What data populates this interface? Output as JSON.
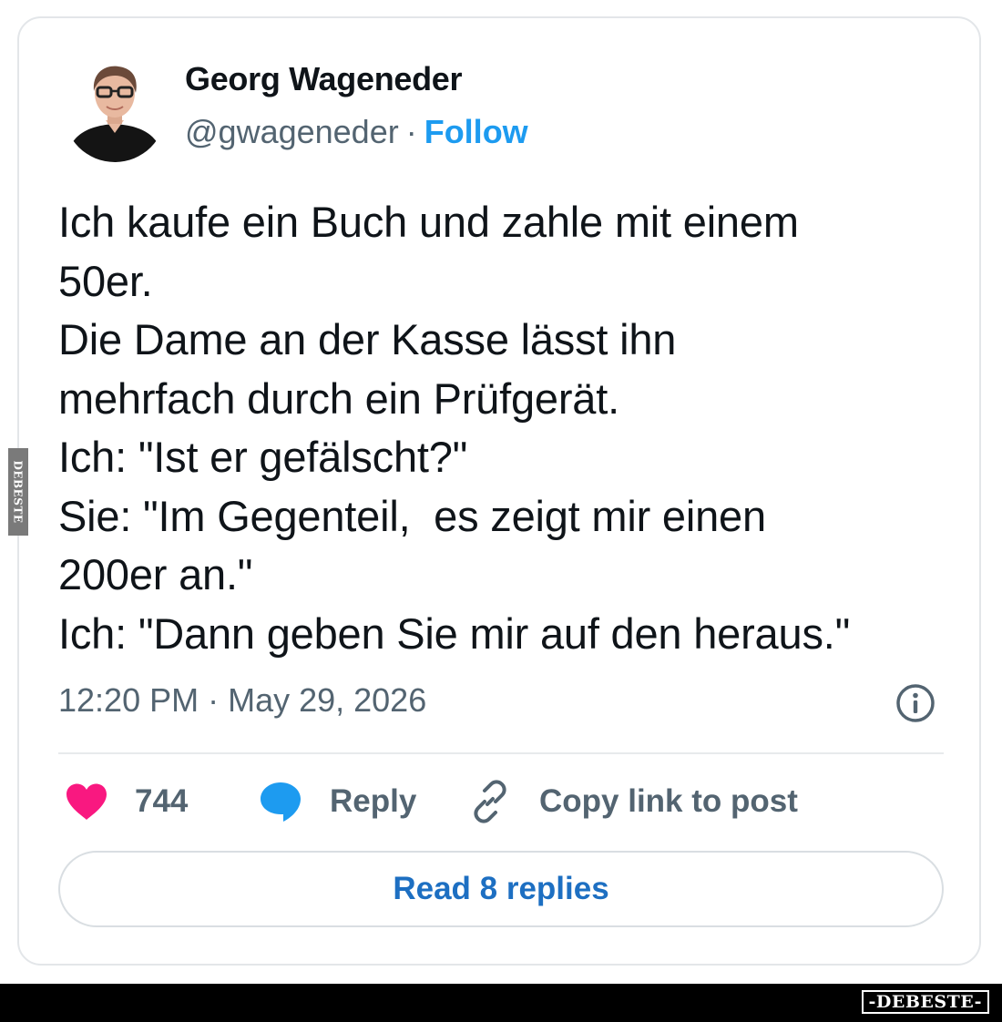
{
  "author": {
    "name": "Georg Wageneder",
    "handle": "@gwageneder",
    "separator": "·",
    "follow_label": "Follow"
  },
  "tweet": {
    "text": "Ich kaufe ein Buch und zahle mit einem\n50er.\nDie Dame an der Kasse lässt ihn\nmehrfach durch ein Prüfgerät.\nIch: \"Ist er gefälscht?\"\nSie: \"Im Gegenteil,  es zeigt mir einen\n200er an.\"\nIch: \"Dann geben Sie mir auf den heraus.\"",
    "timestamp": "12:20 PM · May 29, 2026"
  },
  "actions": {
    "like_count": "744",
    "reply_label": "Reply",
    "copy_label": "Copy link to post",
    "read_replies_label": "Read 8 replies"
  },
  "icons": {
    "like": "heart-icon",
    "reply": "speech-bubble-icon",
    "copy": "link-icon",
    "info": "info-icon"
  },
  "colors": {
    "like": "#f91880",
    "reply": "#1d9bf0",
    "follow": "#1d9bf0",
    "read_replies": "#1d6fc2",
    "secondary_text": "#536471"
  },
  "watermark": {
    "side_text": "DEBESTE",
    "bottom_text": "-DEBESTE-"
  }
}
